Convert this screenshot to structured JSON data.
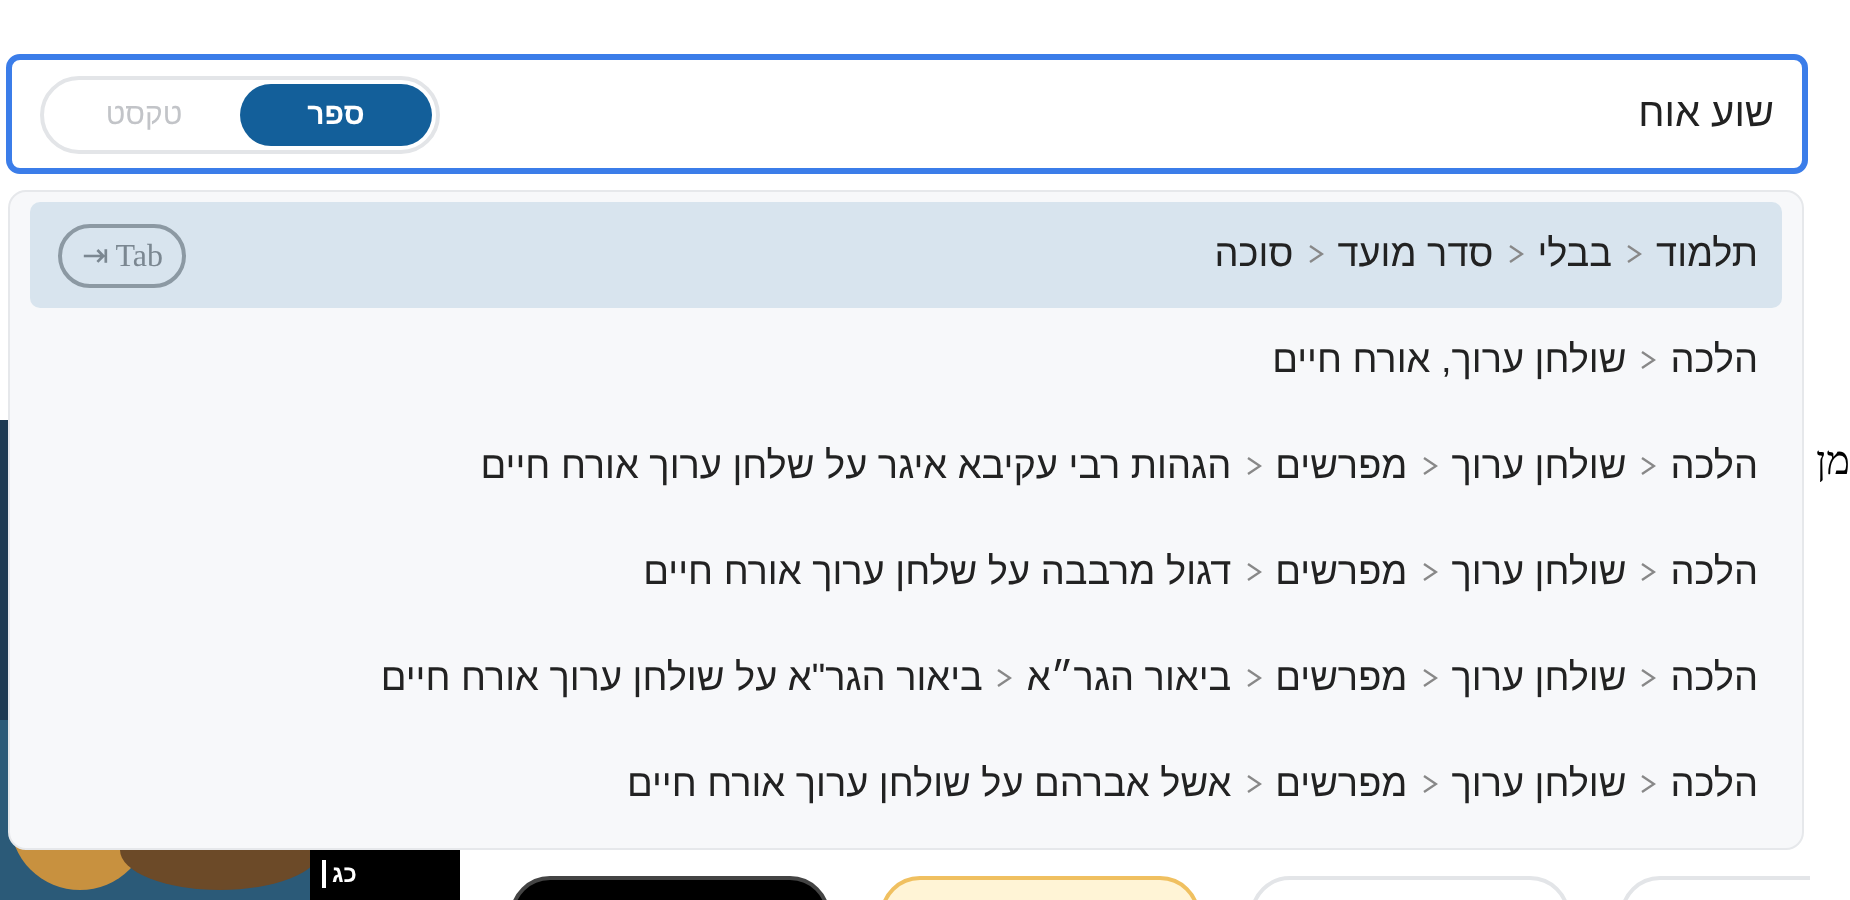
{
  "search": {
    "value": "שוע אוח",
    "modes": [
      {
        "label": "ספר",
        "selected": true
      },
      {
        "label": "טקסט",
        "selected": false
      }
    ]
  },
  "suggestions": [
    {
      "path": [
        "תלמוד",
        "בבלי",
        "סדר מועד",
        "סוכה"
      ],
      "selected": true,
      "hint": "⇥ Tab"
    },
    {
      "path": [
        "הלכה",
        "שולחן ערוך, אורח חיים"
      ],
      "selected": false
    },
    {
      "path": [
        "הלכה",
        "שולחן ערוך",
        "מפרשים",
        "הגהות רבי עקיבא איגר על שלחן ערוך אורח חיים"
      ],
      "selected": false
    },
    {
      "path": [
        "הלכה",
        "שולחן ערוך",
        "מפרשים",
        "דגול מרבבה על שלחן ערוך אורח חיים"
      ],
      "selected": false
    },
    {
      "path": [
        "הלכה",
        "שולחן ערוך",
        "מפרשים",
        "ביאור הגר״א",
        "ביאור הגר\"א על שולחן ערוך אורח חיים"
      ],
      "selected": false
    },
    {
      "path": [
        "הלכה",
        "שולחן ערוך",
        "מפרשים",
        "אשל אברהם על שולחן ערוך אורח חיים"
      ],
      "selected": false
    }
  ],
  "background": {
    "picture_label": "כג",
    "side_texts": [
      "מן"
    ],
    "buttons": [
      {
        "kind": "dark"
      },
      {
        "kind": "highlight"
      },
      {
        "kind": "plain"
      },
      {
        "kind": "plain"
      }
    ]
  }
}
